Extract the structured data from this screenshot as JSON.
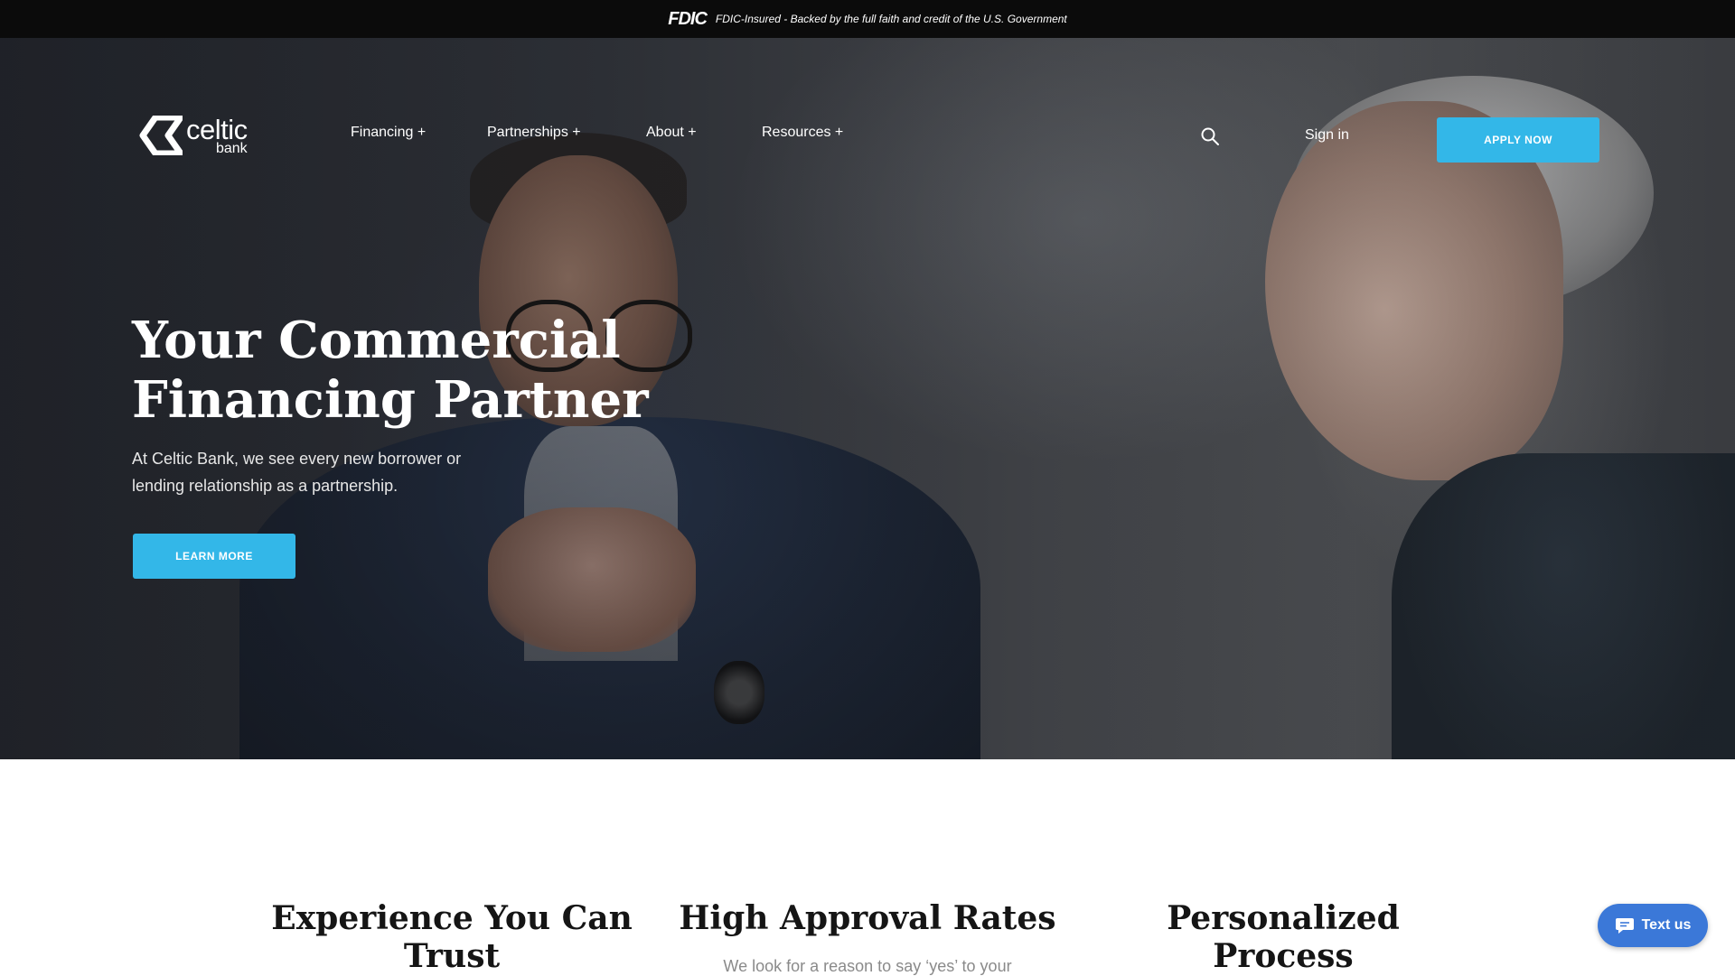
{
  "banner": {
    "logo": "FDIC",
    "text": "FDIC-Insured - Backed by the full faith and credit of the U.S. Government"
  },
  "header": {
    "logo_word": "celtic",
    "logo_sub": "bank",
    "nav": [
      {
        "label": "Financing +"
      },
      {
        "label": "Partnerships +"
      },
      {
        "label": "About +"
      },
      {
        "label": "Resources +"
      }
    ],
    "sign_in": "Sign in",
    "apply_label": "APPLY NOW"
  },
  "hero": {
    "title_line1": "Your Commercial",
    "title_line2": "Financing Partner",
    "desc_line1": "At Celtic Bank, we see every new borrower or",
    "desc_line2": "lending relationship as a partnership.",
    "cta_label": "LEARN MORE"
  },
  "features": [
    {
      "title_line1": "Experience You Can",
      "title_line2": "Trust",
      "text": ""
    },
    {
      "title_line1": "High Approval Rates",
      "title_line2": "",
      "text": "We look for a reason to say ‘yes’ to your"
    },
    {
      "title_line1": "Personalized",
      "title_line2": "Process",
      "text": ""
    }
  ],
  "chat": {
    "label": "Text us"
  },
  "colors": {
    "accent": "#33b7e8",
    "banner_bg": "#0b0b0b",
    "chat_bg": "#3b78d8"
  }
}
